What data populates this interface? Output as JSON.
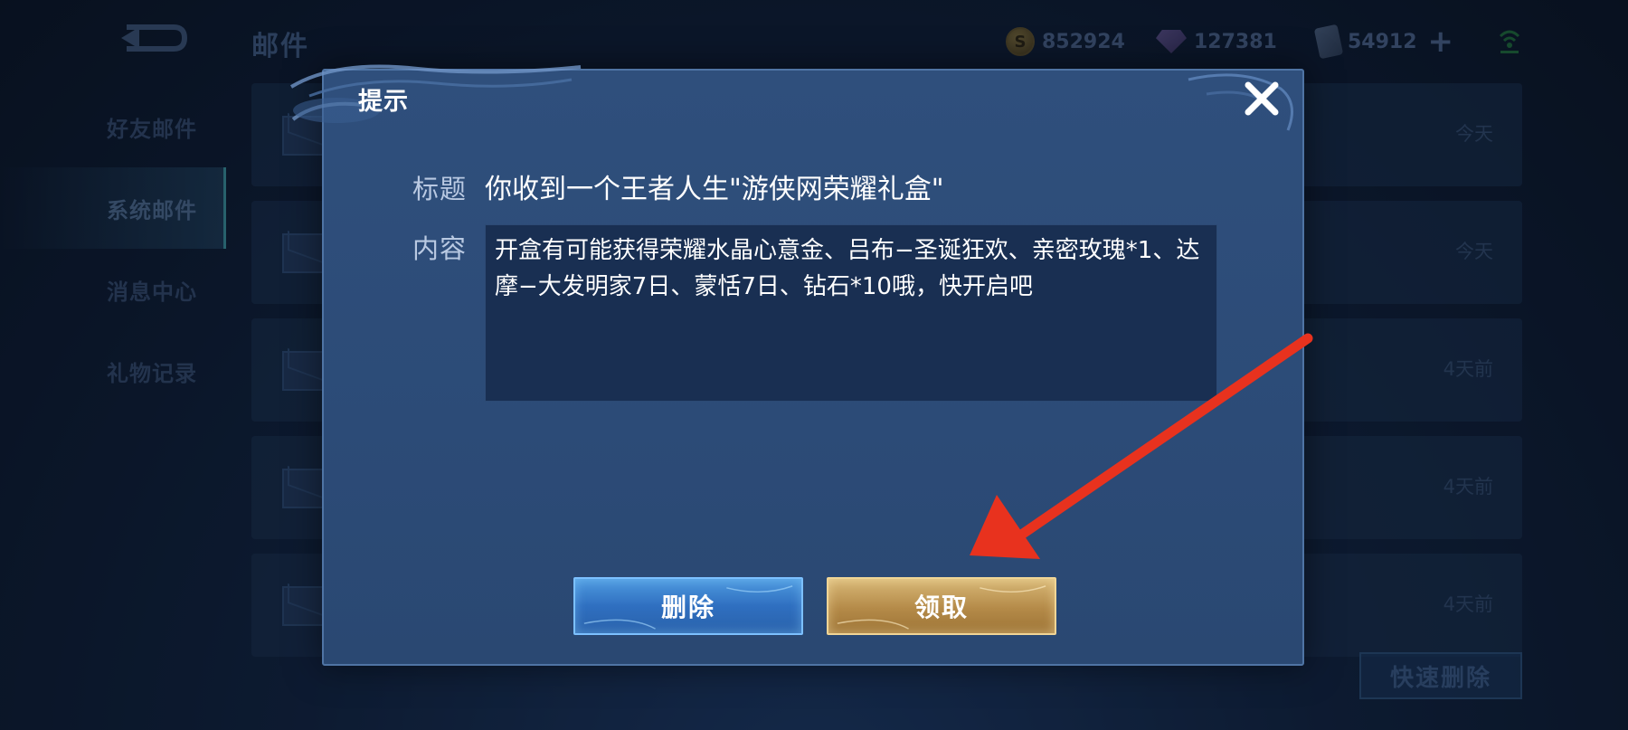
{
  "header": {
    "title": "邮件",
    "currencies": [
      {
        "icon": "gold-coin-icon",
        "value": "852924"
      },
      {
        "icon": "diamond-icon",
        "value": "127381"
      },
      {
        "icon": "coupon-icon",
        "value": "54912"
      }
    ]
  },
  "sidebar": {
    "items": [
      {
        "label": "好友邮件",
        "active": false
      },
      {
        "label": "系统邮件",
        "active": true
      },
      {
        "label": "消息中心",
        "active": false
      },
      {
        "label": "礼物记录",
        "active": false
      }
    ]
  },
  "mail_list": {
    "rows": [
      {
        "time": "今天"
      },
      {
        "time": "今天"
      },
      {
        "time": "4天前"
      },
      {
        "time": "4天前"
      },
      {
        "time": "4天前"
      }
    ],
    "quick_delete_label": "快速删除"
  },
  "dialog": {
    "title": "提示",
    "title_field_label": "标题",
    "title_value": "你收到一个王者人生\"游侠网荣耀礼盒\"",
    "content_field_label": "内容",
    "content_value": "开盒有可能获得荣耀水晶心意金、吕布−圣诞狂欢、亲密玫瑰*1、达摩−大发明家7日、蒙恬7日、钻石*10哦，快开启吧",
    "delete_label": "删除",
    "claim_label": "领取"
  },
  "colors": {
    "annotation_arrow": "#e8321e",
    "claim_button": "#c9a25e",
    "delete_button": "#3a82d0"
  }
}
